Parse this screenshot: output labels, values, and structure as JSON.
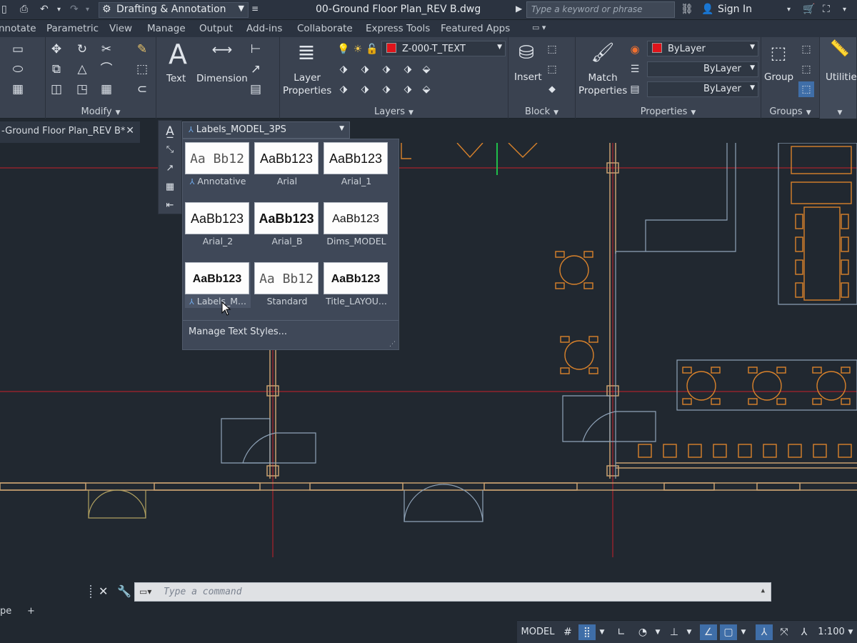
{
  "titlebar": {
    "workspace": "Drafting & Annotation",
    "document_title": "00-Ground Floor Plan_REV B.dwg",
    "search_placeholder": "Type a keyword or phrase",
    "sign_in": "Sign In"
  },
  "menu_tabs": [
    "nnotate",
    "Parametric",
    "View",
    "Manage",
    "Output",
    "Add-ins",
    "Collaborate",
    "Express Tools",
    "Featured Apps"
  ],
  "ribbon": {
    "modify_label": "Modify",
    "text_label": "Text",
    "dimension_label": "Dimension",
    "layer_properties_label": "Layer\nProperties",
    "layer_current": "Z-000-T_TEXT",
    "layers_label": "Layers",
    "insert_label": "Insert",
    "block_label": "Block",
    "match_properties_label": "Match\nProperties",
    "color_value": "ByLayer",
    "linetype_value": "ByLayer",
    "lineweight_value": "ByLayer",
    "properties_label": "Properties",
    "group_label": "Group",
    "groups_label": "Groups",
    "utilities_label": "Utilities",
    "layer_color": "#e0141b"
  },
  "file_tab": {
    "name": "-Ground Floor Plan_REV B*"
  },
  "text_style": {
    "current": "Labels_MODEL_3PS",
    "manage_label": "Manage Text Styles...",
    "styles": [
      {
        "name": "Annotative",
        "preview": "Aa Bb12",
        "annotative": true
      },
      {
        "name": "Arial",
        "preview": "AaBb123",
        "annotative": false
      },
      {
        "name": "Arial_1",
        "preview": "AaBb123",
        "annotative": false
      },
      {
        "name": "Arial_2",
        "preview": "AaBb123",
        "annotative": false
      },
      {
        "name": "Arial_B",
        "preview": "AaBb123",
        "annotative": false
      },
      {
        "name": "Dims_MODEL",
        "preview": "AaBb123",
        "annotative": false
      },
      {
        "name": "Labels_M...",
        "preview": "AaBb123",
        "annotative": true
      },
      {
        "name": "Standard",
        "preview": "Aa Bb12",
        "annotative": false
      },
      {
        "name": "Title_LAYOU...",
        "preview": "AaBb123",
        "annotative": false
      }
    ]
  },
  "command_line": {
    "placeholder": "Type a command"
  },
  "layout_tabs": {
    "model_tab": "pe",
    "add": "+"
  },
  "statusbar": {
    "model": "MODEL",
    "scale": "1:100"
  },
  "colors": {
    "background": "#212830",
    "ribbon": "#3a4250",
    "furniture": "#d9822b",
    "wall_line": "#c8a070",
    "gridline": "#c8202a",
    "partition": "#8fa3b8"
  }
}
